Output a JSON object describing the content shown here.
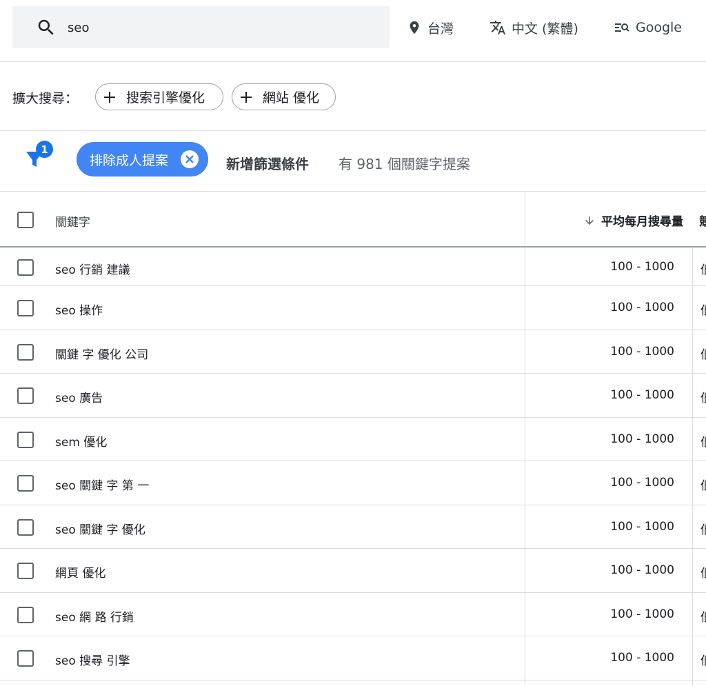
{
  "search": {
    "value": "seo",
    "placeholder": ""
  },
  "top_options": {
    "location": "台灣",
    "language": "中文 (繁體)",
    "network": "Google"
  },
  "broaden": {
    "label": "擴大搜尋：",
    "chips": [
      "搜索引擎優化",
      "網站 優化"
    ]
  },
  "filters": {
    "badge_count": "1",
    "active_filter": "排除成人提案",
    "add_filter": "新增篩選條件",
    "result_count_text": "有 981 個關鍵字提案"
  },
  "table": {
    "columns": {
      "keyword": "關鍵字",
      "volume": "平均每月搜尋量",
      "next_partial": "競"
    },
    "rows": [
      {
        "keyword": "seo 行銷 建議",
        "volume": "100 - 1000",
        "next_partial": "低"
      },
      {
        "keyword": "seo 操作",
        "volume": "100 - 1000",
        "next_partial": "低"
      },
      {
        "keyword": "關鍵 字 優化 公司",
        "volume": "100 - 1000",
        "next_partial": "低"
      },
      {
        "keyword": "seo 廣告",
        "volume": "100 - 1000",
        "next_partial": "低"
      },
      {
        "keyword": "sem 優化",
        "volume": "100 - 1000",
        "next_partial": "低"
      },
      {
        "keyword": "seo 關鍵 字 第 一",
        "volume": "100 - 1000",
        "next_partial": "低"
      },
      {
        "keyword": "seo 關鍵 字 優化",
        "volume": "100 - 1000",
        "next_partial": "低"
      },
      {
        "keyword": "網頁 優化",
        "volume": "100 - 1000",
        "next_partial": "低"
      },
      {
        "keyword": "seo 網 路 行銷",
        "volume": "100 - 1000",
        "next_partial": "低"
      },
      {
        "keyword": "seo 搜尋 引擎",
        "volume": "100 - 1000",
        "next_partial": "低"
      }
    ]
  },
  "colors": {
    "accent": "#1a73e8",
    "chip_blue": "#4285f4",
    "divider": "#dadce0"
  },
  "icons": [
    "search-icon",
    "location-pin-icon",
    "translate-icon",
    "network-search-icon",
    "plus-icon",
    "filter-icon",
    "close-circle-icon",
    "arrow-down-icon",
    "checkbox-icon"
  ]
}
